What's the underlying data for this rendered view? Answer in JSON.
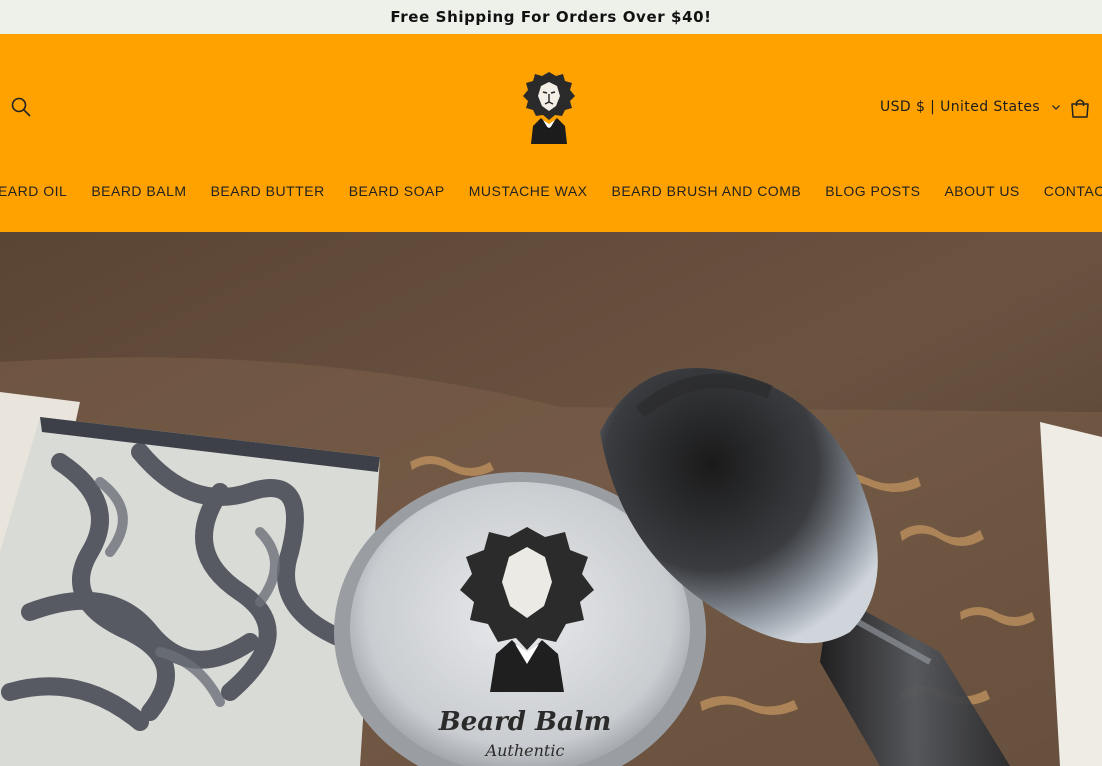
{
  "announcement": {
    "text": "Free Shipping For Orders Over $40!"
  },
  "header": {
    "search_icon": "search-icon",
    "logo_icon": "lion-logo",
    "currency_label": "USD $ | United States",
    "currency_icon": "chevron-down-icon",
    "cart_icon": "cart-icon"
  },
  "nav": {
    "items": [
      {
        "label": "BEARD OIL"
      },
      {
        "label": "BEARD BALM"
      },
      {
        "label": "BEARD BUTTER"
      },
      {
        "label": "BEARD SOAP"
      },
      {
        "label": "MUSTACHE WAX"
      },
      {
        "label": "BEARD BRUSH AND COMB"
      },
      {
        "label": "BLOG POSTS"
      },
      {
        "label": "ABOUT US"
      },
      {
        "label": "CONTACT"
      }
    ]
  },
  "hero": {
    "tin_title": "Beard Balm",
    "tin_subtitle": "Authentic"
  },
  "colors": {
    "header_bg": "#ffa200",
    "announcement_bg": "#eef0ea"
  }
}
